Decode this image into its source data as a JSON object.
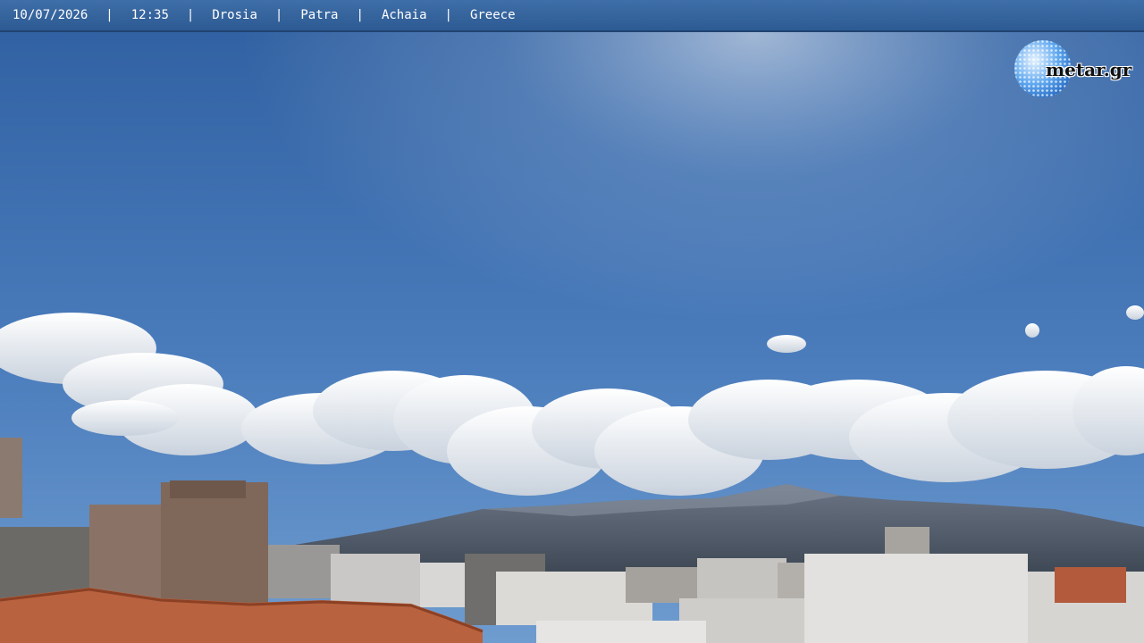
{
  "overlay": {
    "date": "10/07/2026",
    "time": "12:35",
    "area": "Drosia",
    "city": "Patra",
    "region": "Achaia",
    "country": "Greece",
    "separator": "|"
  },
  "logo": {
    "text": "metar.gr",
    "icon": "globe-icon"
  },
  "colors": {
    "bar": "#2d5a93",
    "sky_top": "#3a6aa8",
    "sky_bottom": "#5b8cc5",
    "cloud": "#f2f4f7",
    "mountain": "#5c6775"
  }
}
